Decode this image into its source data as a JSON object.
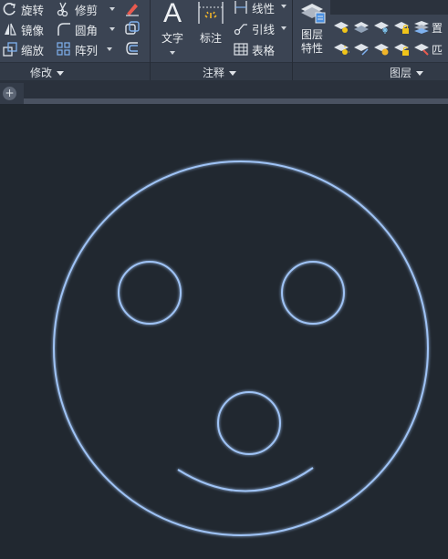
{
  "ribbon": {
    "modify": {
      "title": "修改",
      "rotate": "旋转",
      "mirror": "镜像",
      "scale": "缩放",
      "trim": "修剪",
      "fillet": "圆角",
      "array": "阵列"
    },
    "annotation": {
      "title": "注释",
      "text": "文字",
      "dimension": "标注",
      "linear": "线性",
      "leader": "引线",
      "table": "表格"
    },
    "layers": {
      "title": "图层",
      "layer_properties_line1": "图层",
      "layer_properties_line2": "特性",
      "cut_right_1": "置",
      "cut_right_2": "匹"
    }
  },
  "tabs": {
    "new_tab": "+"
  },
  "drawing": {
    "stroke_color": "#9fc3f5",
    "glow_color": "#4f7fd6",
    "objects": [
      "face-circle",
      "left-eye-circle",
      "right-eye-circle",
      "mouth-circle",
      "smile-arc"
    ]
  }
}
